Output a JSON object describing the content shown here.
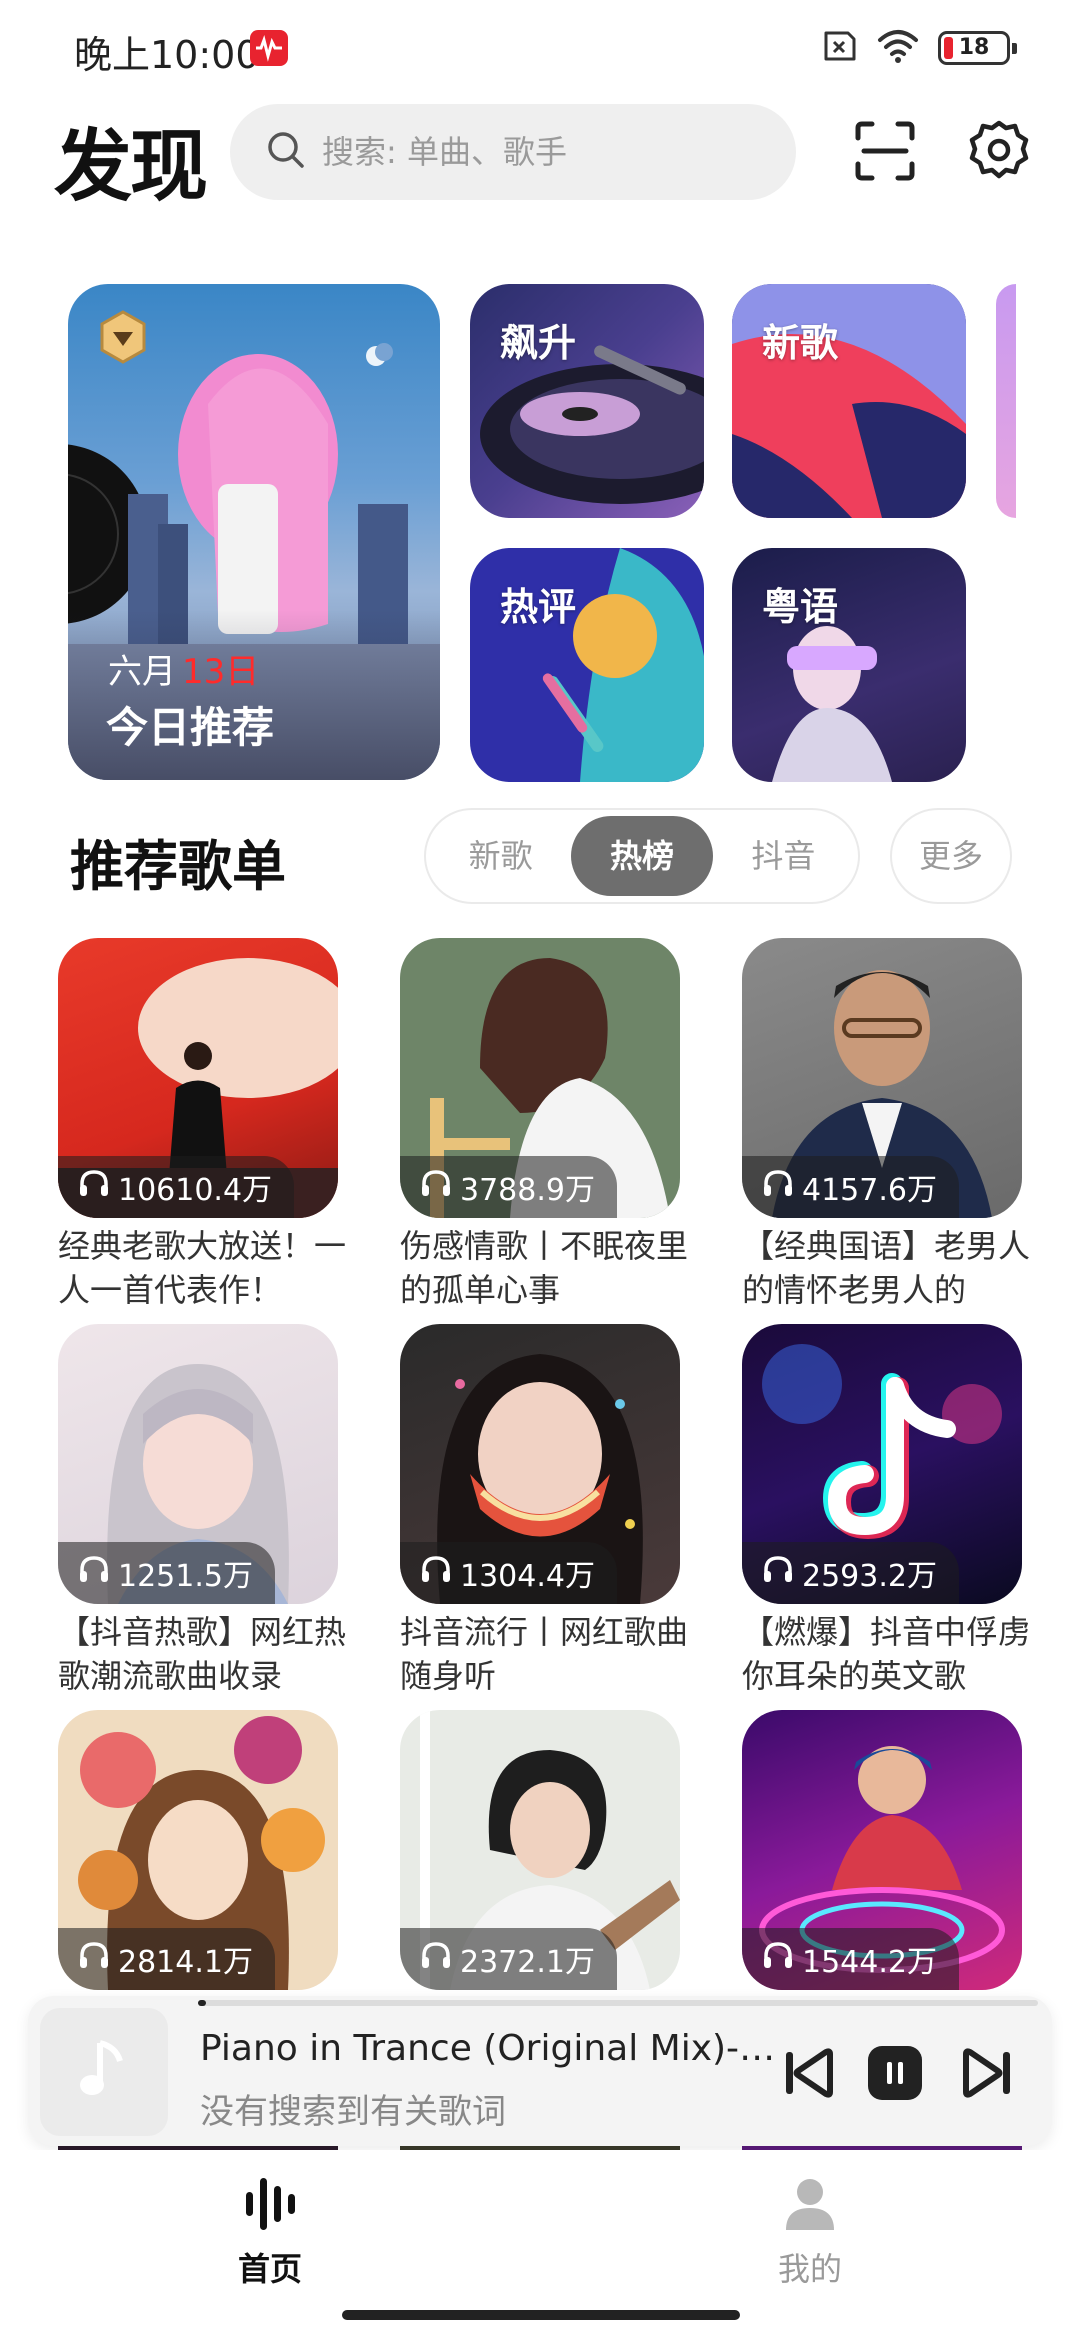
{
  "status_bar": {
    "time": "晚上10:00",
    "battery": "18"
  },
  "header": {
    "title": "发现",
    "search_placeholder": "搜索: 单曲、歌手",
    "icons": [
      "scan-icon",
      "settings-icon"
    ]
  },
  "banners": {
    "daily": {
      "month": "六月",
      "day": "13日",
      "label": "今日推荐"
    },
    "tiles": [
      {
        "label": "飙升"
      },
      {
        "label": "新歌"
      },
      {
        "label": "热评"
      },
      {
        "label": "粤语"
      }
    ]
  },
  "recommend": {
    "title": "推荐歌单",
    "tabs": [
      "新歌",
      "热榜",
      "抖音"
    ],
    "active_tab": "热榜",
    "more": "更多",
    "playlists": [
      {
        "count": "10610.4万",
        "caption": "经典老歌大放送！一人一首代表作！"
      },
      {
        "count": "3788.9万",
        "caption": "伤感情歌丨不眠夜里的孤单心事"
      },
      {
        "count": "4157.6万",
        "caption": "【经典国语】老男人的情怀老男人的"
      },
      {
        "count": "1251.5万",
        "caption": "【抖音热歌】网红热歌潮流歌曲收录"
      },
      {
        "count": "1304.4万",
        "caption": "抖音流行丨网红歌曲随身听"
      },
      {
        "count": "2593.2万",
        "caption": "【燃爆】抖音中俘虏你耳朵的英文歌"
      },
      {
        "count": "2814.1万",
        "caption": ""
      },
      {
        "count": "2372.1万",
        "caption": ""
      },
      {
        "count": "1544.2万",
        "caption": ""
      }
    ]
  },
  "player": {
    "song": "Piano in Trance (Original Mix)-C...",
    "lyric": "没有搜索到有关歌词",
    "progress": 0.01
  },
  "nav": {
    "items": [
      {
        "label": "首页",
        "icon": "waveform-icon",
        "active": true
      },
      {
        "label": "我的",
        "icon": "user-icon",
        "active": false
      }
    ]
  },
  "colors": {
    "accent_red": "#e8232f",
    "active_tab_bg": "#6e6e6e"
  }
}
